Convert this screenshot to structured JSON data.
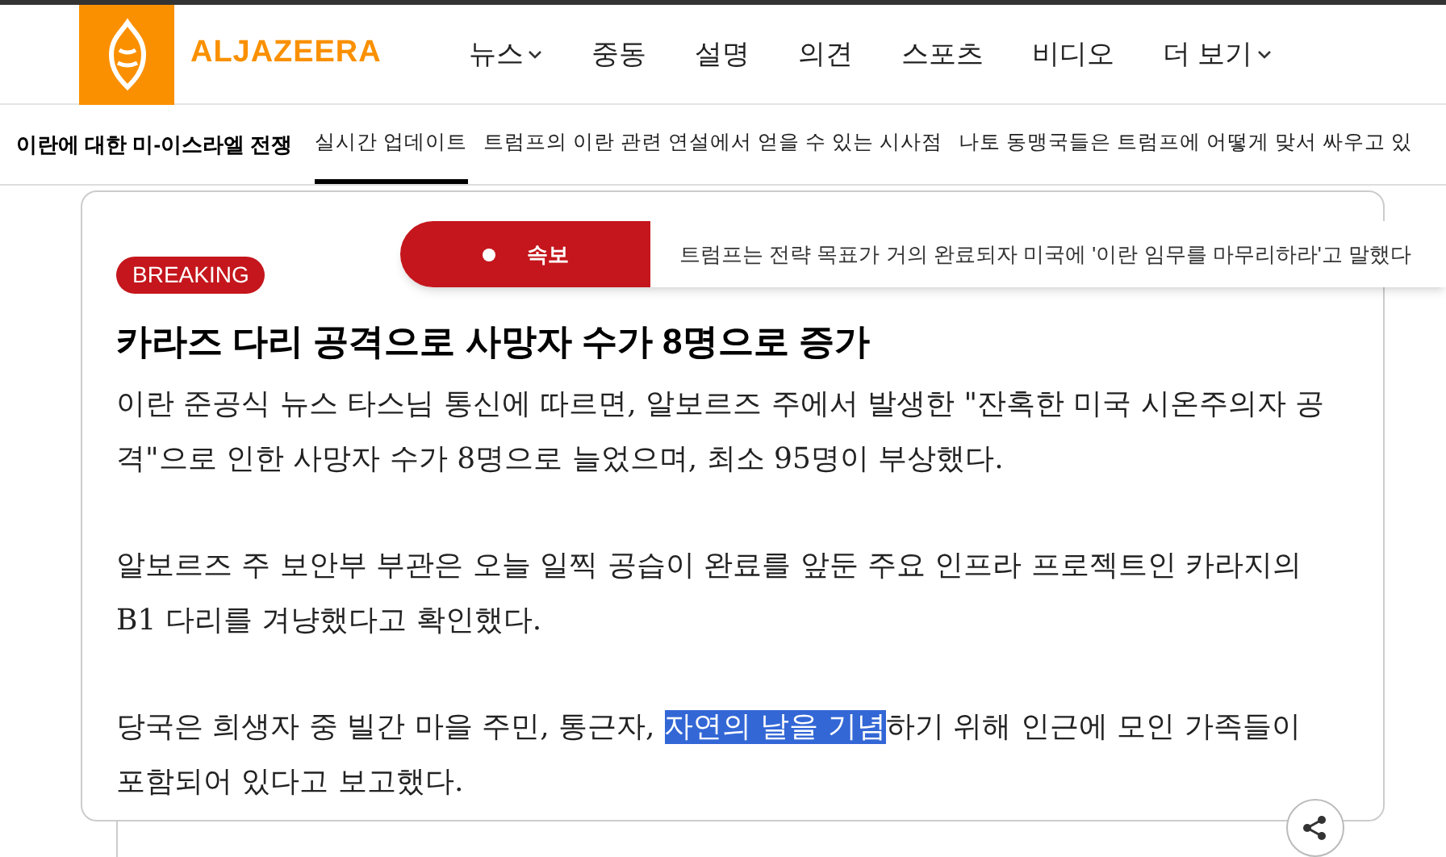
{
  "header": {
    "logo_text": "ALJAZEERA",
    "nav": [
      {
        "label": "뉴스",
        "dropdown": true
      },
      {
        "label": "중동",
        "dropdown": false
      },
      {
        "label": "설명",
        "dropdown": false
      },
      {
        "label": "의견",
        "dropdown": false
      },
      {
        "label": "스포츠",
        "dropdown": false
      },
      {
        "label": "비디오",
        "dropdown": false
      },
      {
        "label": "더 보기",
        "dropdown": true
      }
    ]
  },
  "subnav": {
    "title": "이란에 대한 미-이스라엘 전쟁",
    "links": [
      {
        "label": "실시간 업데이트",
        "selected": true
      },
      {
        "label": "트럼프의 이란 관련 연설에서 얻을 수 있는 시사점",
        "selected": false
      },
      {
        "label": "나토 동맹국들은 트럼프에 어떻게 맞서 싸우고 있",
        "selected": false
      }
    ]
  },
  "ticker": {
    "label": "속보",
    "text": "트럼프는 전략 목표가 거의 완료되자 미국에 '이란 임무를 마무리하라'고 말했다"
  },
  "post": {
    "badge": "BREAKING",
    "headline": "카라즈 다리 공격으로 사망자 수가 8명으로 증가",
    "paragraphs": [
      [
        {
          "text": "이란 준공식 뉴스 타스님 통신에 따르면, 알보르즈 주에서 발생한 \"잔혹한 미국 시온주의자 공격\"으로 인한 사망자 수가 8명으로 늘었으며, 최소 95명이 부상했다.",
          "selected": false
        }
      ],
      [
        {
          "text": "알보르즈 주 보안부 부관은 오늘 일찍 공습이 완료를 앞둔 주요 인프라 프로젝트인 카라지의 B1 다리를 겨냥했다고 확인했다.",
          "selected": false
        }
      ],
      [
        {
          "text": "당국은 희생자 중 빌간 마을 주민, 통근자, ",
          "selected": false
        },
        {
          "text": "자연의 날을 기념",
          "selected": true
        },
        {
          "text": "하기 위해 인근에 모인 가족들이 포함되어 있다고 보고했다.",
          "selected": false
        }
      ]
    ]
  }
}
